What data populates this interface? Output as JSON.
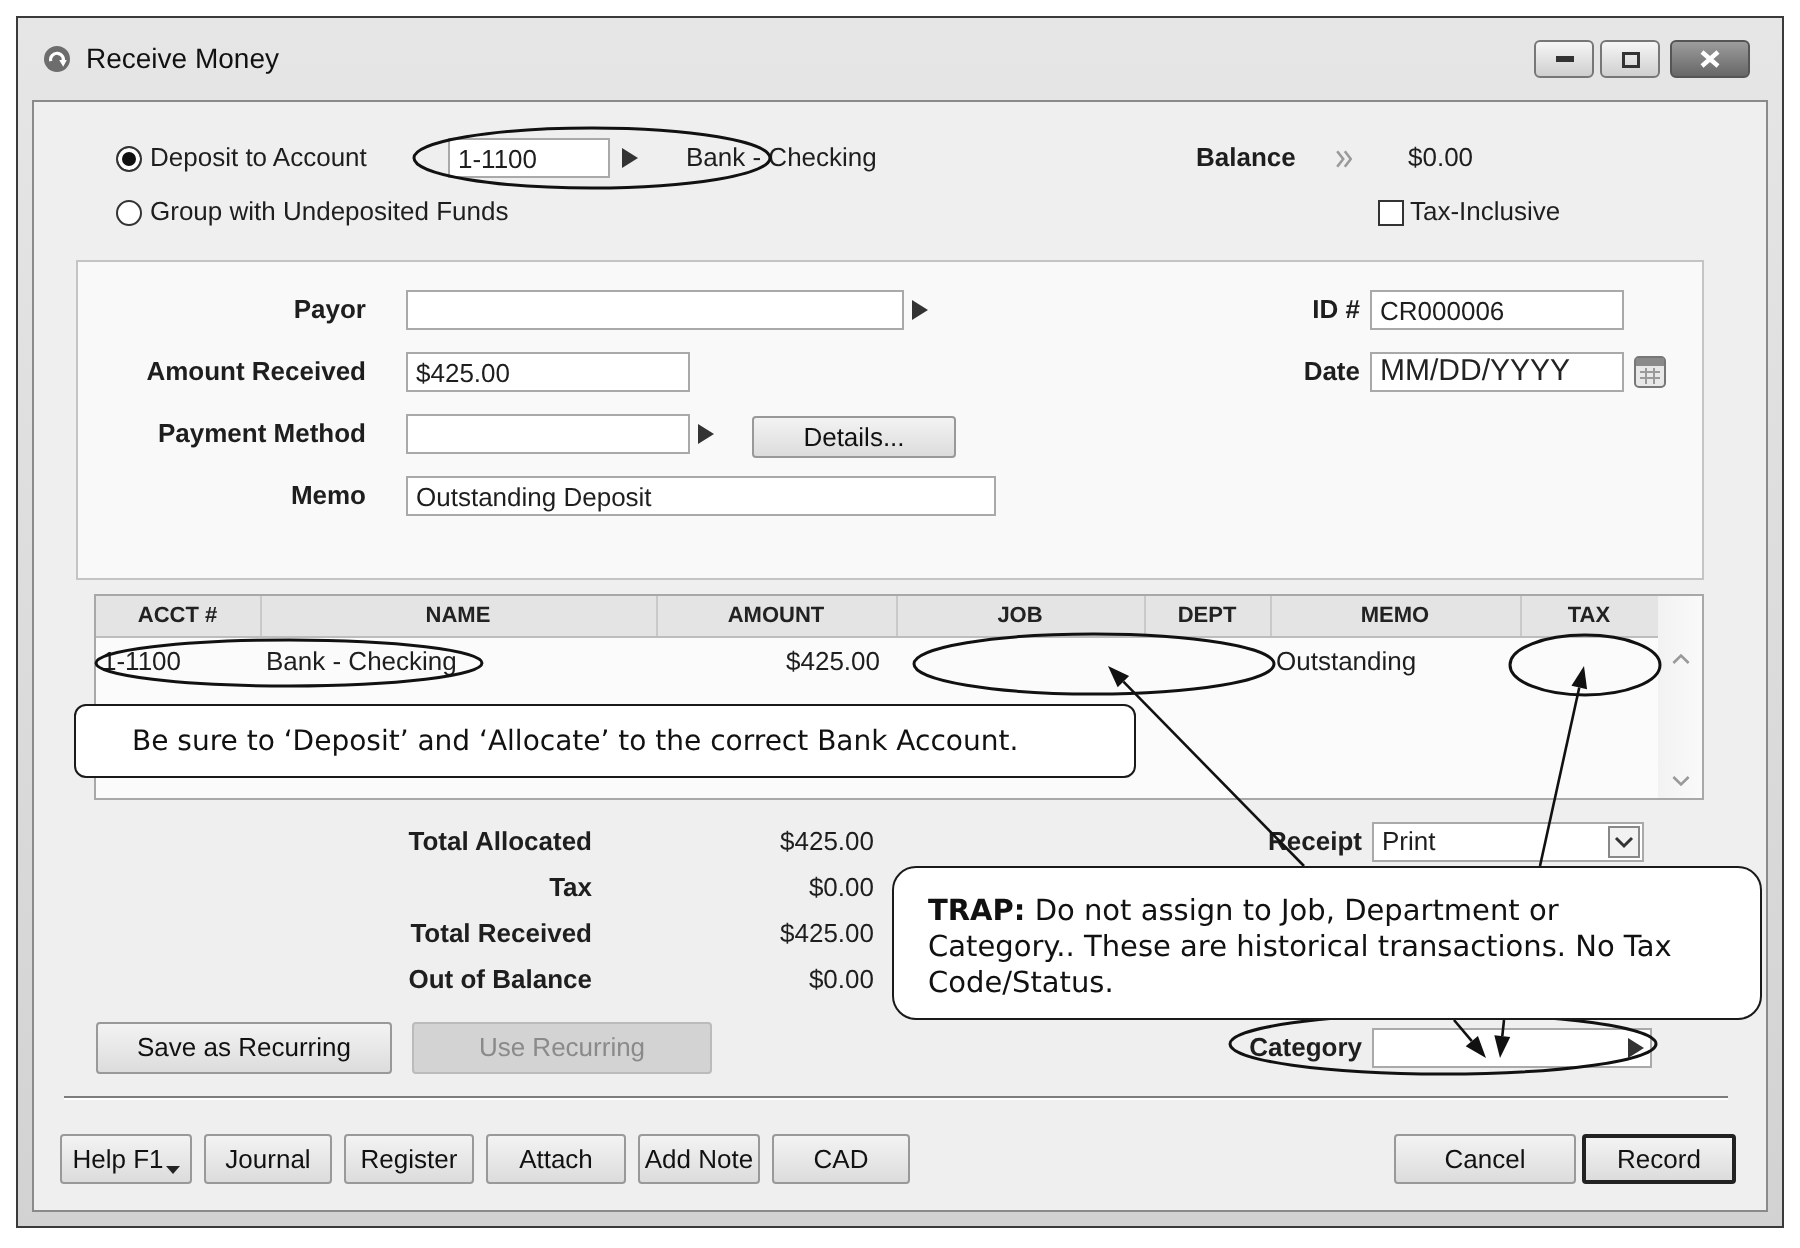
{
  "window": {
    "title": "Receive Money"
  },
  "deposit_options": [
    {
      "label": "Deposit to Account",
      "selected": true
    },
    {
      "label": "Group with Undeposited Funds",
      "selected": false
    }
  ],
  "deposit_account": {
    "number": "1-1100",
    "name": "Bank - Checking"
  },
  "balance": {
    "label": "Balance",
    "value": "$0.00"
  },
  "tax_inclusive": {
    "label": "Tax-Inclusive",
    "checked": false
  },
  "form_fields": [
    {
      "kind": "lookup",
      "label": "Payor"
    },
    {
      "kind": "text",
      "label": "Amount Received",
      "value": "$425.00"
    },
    {
      "kind": "lookup",
      "label": "Payment Method",
      "button": {
        "label": "Details..."
      }
    },
    {
      "kind": "text",
      "label": "Memo",
      "value": "Outstanding Deposit"
    }
  ],
  "id_fields": [
    {
      "kind": "text",
      "label": "ID #",
      "value": "CR000006"
    },
    {
      "kind": "date",
      "label": "Date",
      "placeholder": "MM/DD/YYYY"
    }
  ],
  "table": {
    "columns": [
      "ACCT #",
      "NAME",
      "AMOUNT",
      "JOB",
      "DEPT",
      "MEMO",
      "TAX"
    ],
    "rows": [
      {
        "acct_no": "1-1100",
        "name": "Bank - Checking",
        "amount": "$425.00",
        "memo": "Outstanding"
      }
    ]
  },
  "totals": [
    {
      "label": "Total Allocated",
      "value": "$425.00"
    },
    {
      "label": "Tax",
      "value": "$0.00"
    },
    {
      "label": "Total Received",
      "value": "$425.00"
    },
    {
      "label": "Out of Balance",
      "value": "$0.00"
    }
  ],
  "receipt": {
    "label": "Receipt",
    "value": "Print"
  },
  "category": {
    "label": "Category"
  },
  "recurring_buttons": [
    {
      "label": "Save as Recurring",
      "disabled": false
    },
    {
      "label": "Use Recurring",
      "disabled": true
    }
  ],
  "action_buttons": [
    {
      "kind": "menu",
      "label": "Help F1"
    },
    {
      "kind": "plain",
      "label": "Journal"
    },
    {
      "kind": "plain",
      "label": "Register"
    },
    {
      "kind": "plain",
      "label": "Attach"
    },
    {
      "kind": "plain",
      "label": "Add Note"
    },
    {
      "kind": "plain",
      "label": "CAD"
    }
  ],
  "dialog_buttons": [
    {
      "label": "Cancel",
      "default": false
    },
    {
      "label": "Record",
      "default": true
    }
  ],
  "callouts": [
    {
      "text": "Be sure to ‘Deposit’ and ‘Allocate’ to the correct Bank Account."
    },
    {
      "text": "**TRAP:** Do not assign to Job, Department or Category.. These are historical transactions. No Tax Code/Status."
    }
  ]
}
